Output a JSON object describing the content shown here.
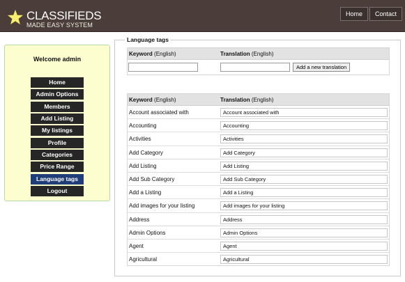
{
  "header": {
    "logo_line1": "CLASSIFIEDS",
    "logo_line2": "MADE EASY SYSTEM",
    "nav": [
      "Home",
      "Contact"
    ]
  },
  "sidebar": {
    "welcome": "Welcome admin",
    "menu": [
      "Home",
      "Admin Options",
      "Members",
      "Add Listing",
      "My listings",
      "Profile",
      "Categories",
      "Price Range",
      "Language tags",
      "Logout"
    ],
    "active_item": "Language tags"
  },
  "main": {
    "legend": "Language tags",
    "add_section": {
      "keyword_header": "Keyword",
      "keyword_header_suffix": "(English)",
      "translation_header": "Translation",
      "translation_header_suffix": "(English)",
      "keyword_value": "",
      "translation_value": "",
      "button_label": "Add a new translation"
    },
    "list_section": {
      "keyword_header": "Keyword",
      "keyword_header_suffix": "(English)",
      "translation_header": "Translation",
      "translation_header_suffix": "(English)",
      "rows": [
        {
          "keyword": "Account associated with",
          "translation": "Account associated with"
        },
        {
          "keyword": "Accounting",
          "translation": "Accounting"
        },
        {
          "keyword": "Activities",
          "translation": "Activities"
        },
        {
          "keyword": "Add Category",
          "translation": "Add Category"
        },
        {
          "keyword": "Add Listing",
          "translation": "Add Listing"
        },
        {
          "keyword": "Add Sub Category",
          "translation": "Add Sub Category"
        },
        {
          "keyword": "Add a Listing",
          "translation": "Add a Listing"
        },
        {
          "keyword": "Add images for your listing",
          "translation": "Add images for your listing"
        },
        {
          "keyword": "Address",
          "translation": "Address"
        },
        {
          "keyword": "Admin Options",
          "translation": "Admin Options"
        },
        {
          "keyword": "Agent",
          "translation": "Agent"
        },
        {
          "keyword": "Agricultural",
          "translation": "Agricultural"
        }
      ]
    }
  },
  "colors": {
    "header_bg": "#4a3d3a",
    "sidebar_bg": "#fdfed0",
    "menu_bg": "#262626",
    "menu_active_bg": "#1f3d78",
    "logo_star": "#f6ee6c"
  },
  "icons": {
    "logo": "star-icon"
  }
}
